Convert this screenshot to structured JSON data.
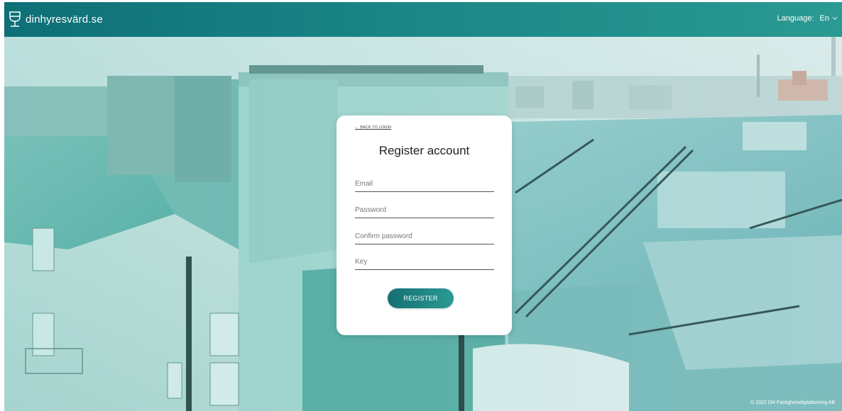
{
  "header": {
    "brand_icon": "wine-glass-icon",
    "brand_name": "dinhyresvärd.se",
    "language_label": "Language:",
    "language_value": "En"
  },
  "card": {
    "back_link": "← BACK TO LOGIN",
    "title": "Register account",
    "fields": {
      "email_placeholder": "Email",
      "password_placeholder": "Password",
      "confirm_password_placeholder": "Confirm password",
      "key_placeholder": "Key"
    },
    "register_label": "REGISTER"
  },
  "footer": {
    "copyright": "© 2022 DH Fastighetsdigitalisering AB"
  },
  "colors": {
    "header_start": "#0e6f77",
    "header_end": "#2a9a92",
    "button": "#1f8585"
  }
}
